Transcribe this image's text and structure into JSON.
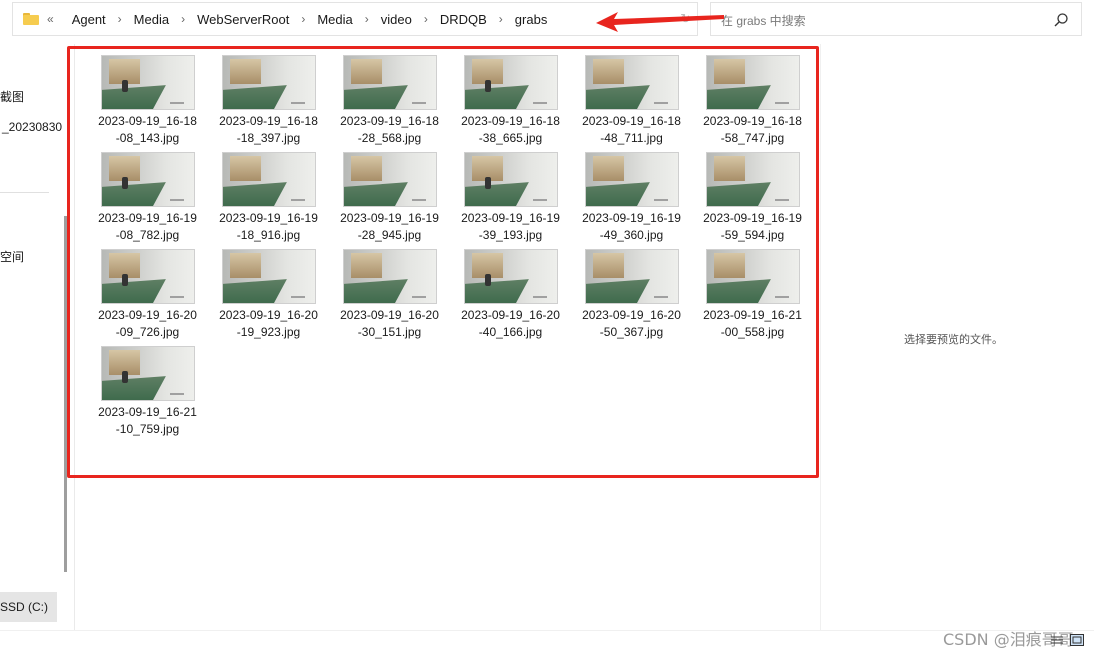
{
  "address_bar": {
    "overflow": "«",
    "breadcrumbs": [
      "Agent",
      "Media",
      "WebServerRoot",
      "Media",
      "video",
      "DRDQB",
      "grabs"
    ],
    "separator": "›"
  },
  "search": {
    "placeholder": "在 grabs 中搜索"
  },
  "nav": {
    "items": [
      "截图",
      "_20230830",
      "空间"
    ],
    "drive": "SSD (C:)"
  },
  "files": [
    "2023-09-19_16-18-08_143.jpg",
    "2023-09-19_16-18-18_397.jpg",
    "2023-09-19_16-18-28_568.jpg",
    "2023-09-19_16-18-38_665.jpg",
    "2023-09-19_16-18-48_711.jpg",
    "2023-09-19_16-18-58_747.jpg",
    "2023-09-19_16-19-08_782.jpg",
    "2023-09-19_16-19-18_916.jpg",
    "2023-09-19_16-19-28_945.jpg",
    "2023-09-19_16-19-39_193.jpg",
    "2023-09-19_16-19-49_360.jpg",
    "2023-09-19_16-19-59_594.jpg",
    "2023-09-19_16-20-09_726.jpg",
    "2023-09-19_16-20-19_923.jpg",
    "2023-09-19_16-20-30_151.jpg",
    "2023-09-19_16-20-40_166.jpg",
    "2023-09-19_16-20-50_367.jpg",
    "2023-09-19_16-21-00_558.jpg",
    "2023-09-19_16-21-10_759.jpg"
  ],
  "preview": {
    "empty_text": "选择要预览的文件。"
  },
  "watermark": "CSDN @泪痕哥哥",
  "colors": {
    "annotation_red": "#e8251e",
    "folder_yellow": "#f6cc4f"
  },
  "icons": [
    "folder-icon",
    "chevron-down-icon",
    "refresh-icon",
    "search-icon",
    "details-view-icon",
    "tiles-view-icon"
  ]
}
